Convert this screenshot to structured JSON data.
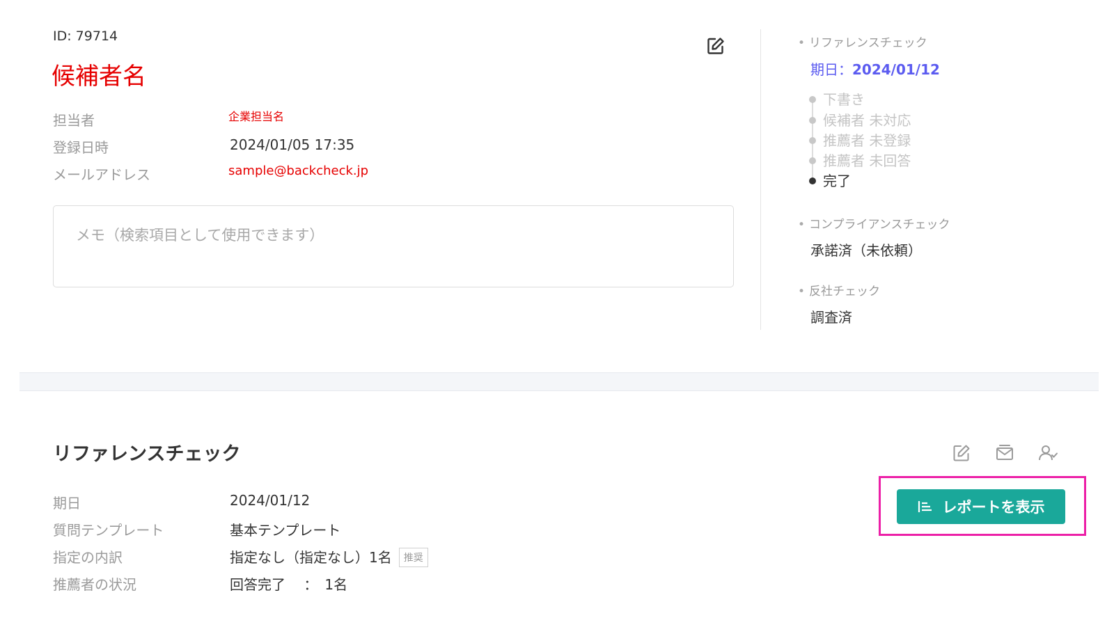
{
  "candidate": {
    "id_text": "ID: 79714",
    "name": "候補者名",
    "rows": [
      {
        "label": "担当者",
        "value": "企業担当名"
      },
      {
        "label": "登録日時",
        "value": "2024/01/05 17:35"
      },
      {
        "label": "メールアドレス",
        "value": "sample@backcheck.jp"
      }
    ],
    "memo_placeholder": "メモ（検索項目として使用できます）"
  },
  "sidebar": {
    "reference": {
      "title": "リファレンスチェック",
      "due_label": "期日：",
      "due_date": "2024/01/12",
      "steps": [
        {
          "label": "下書き",
          "state": "pending"
        },
        {
          "label": "候補者 未対応",
          "state": "pending"
        },
        {
          "label": "推薦者 未登録",
          "state": "pending"
        },
        {
          "label": "推薦者 未回答",
          "state": "pending"
        },
        {
          "label": "完了",
          "state": "done"
        }
      ]
    },
    "compliance": {
      "title": "コンプライアンスチェック",
      "value": "承諾済（未依頼）"
    },
    "antisocial": {
      "title": "反社チェック",
      "value": "調査済"
    }
  },
  "reference_section": {
    "title": "リファレンスチェック",
    "report_button": "レポートを表示",
    "rows": [
      {
        "label": "期日",
        "value": "2024/01/12"
      },
      {
        "label": "質問テンプレート",
        "value": "基本テンプレート"
      },
      {
        "label": "指定の内訳",
        "value": "指定なし（指定なし）1名",
        "badge": "推奨"
      },
      {
        "label": "推薦者の状況",
        "value": "回答完了　 ：　1名"
      }
    ]
  },
  "icons": [
    "edit-icon",
    "mail-icon",
    "user-check-icon",
    "report-list-icon"
  ],
  "colors": {
    "accent": "#1aa89a",
    "highlight": "#ec1fa7",
    "due": "#5b5bf0",
    "name_red": "#e60000"
  }
}
